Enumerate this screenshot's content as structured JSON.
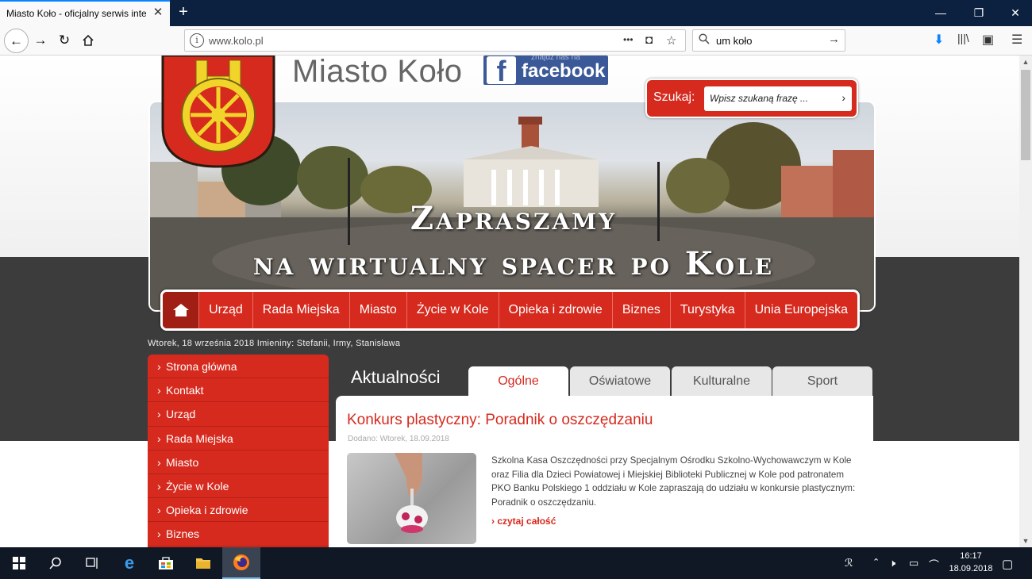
{
  "browser": {
    "tab_title": "Miasto Koło - oficjalny serwis interr",
    "tab_close": "✕",
    "new_tab": "+",
    "url": "www.kolo.pl",
    "url_actions": {
      "more": "•••",
      "pocket": "◘",
      "star": "☆"
    },
    "search_text": "um koło",
    "window_controls": {
      "minimize": "—",
      "restore": "❐",
      "close": "✕"
    }
  },
  "site": {
    "title": "Miasto Koło",
    "facebook": {
      "small": "znajdź nas na",
      "word": "facebook",
      "icon": "f"
    },
    "search": {
      "label": "Szukaj:",
      "placeholder": "Wpisz szukaną frazę ...",
      "arrow": "›"
    },
    "banner": {
      "line1": "Zapraszamy",
      "line2": "na wirtualny spacer po Kole"
    },
    "main_menu": [
      "Urząd",
      "Rada Miejska",
      "Miasto",
      "Życie w Kole",
      "Opieka i zdrowie",
      "Biznes",
      "Turystyka",
      "Unia Europejska"
    ],
    "date_line": "Wtorek, 18 września 2018   Imieniny: Stefanii, Irmy, Stanisława",
    "left_menu": [
      "Strona główna",
      "Kontakt",
      "Urząd",
      "Rada Miejska",
      "Miasto",
      "Życie w Kole",
      "Opieka i zdrowie",
      "Biznes"
    ],
    "news": {
      "heading": "Aktualności",
      "tabs": [
        "Ogólne",
        "Oświatowe",
        "Kulturalne",
        "Sport"
      ],
      "active_tab": 0,
      "article": {
        "title": "Konkurs plastyczny: Poradnik o oszczędzaniu",
        "date": "Dodano: Wtorek, 18.09.2018",
        "body": "Szkolna Kasa Oszczędności przy Specjalnym Ośrodku Szkolno-Wychowawczym w Kole oraz Filia dla Dzieci Powiatowej i Miejskiej Biblioteki Publicznej w Kole pod patronatem PKO Banku Polskiego 1 oddziału w Kole zapraszają do udziału w konkursie plastycznym: Poradnik o oszczędzaniu.",
        "more": "› czytaj całość"
      }
    }
  },
  "taskbar": {
    "time": "16:17",
    "date": "18.09.2018"
  },
  "colors": {
    "accent_red": "#d62a1e",
    "dark_band": "#3c3c3c",
    "facebook_blue": "#3b5998",
    "taskbar": "#101826"
  }
}
